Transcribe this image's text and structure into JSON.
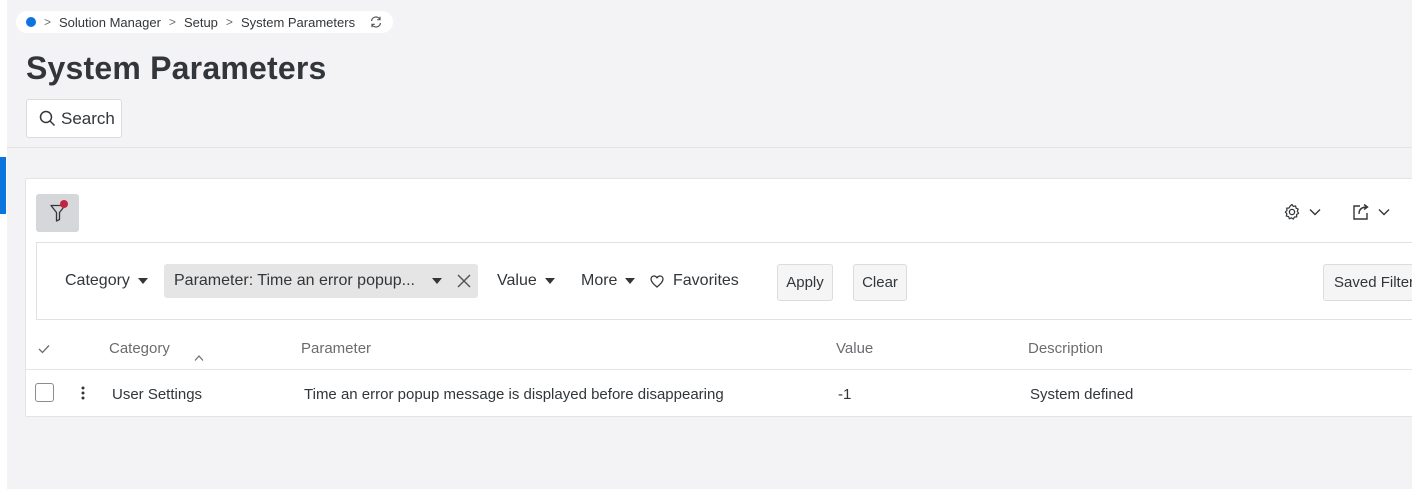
{
  "breadcrumb": {
    "items": [
      "Solution Manager",
      "Setup",
      "System Parameters"
    ]
  },
  "page": {
    "title": "System Parameters"
  },
  "search": {
    "label": "Search"
  },
  "filters": {
    "category_label": "Category",
    "parameter_chip": "Parameter: Time an error popup...",
    "value_label": "Value",
    "more_label": "More",
    "favorites_label": "Favorites",
    "apply_label": "Apply",
    "clear_label": "Clear",
    "saved_filters_label": "Saved Filters"
  },
  "table": {
    "columns": [
      "Category",
      "Parameter",
      "Value",
      "Description"
    ],
    "rows": [
      {
        "category": "User Settings",
        "parameter": "Time an error popup message is displayed before disappearing",
        "value": "-1",
        "description": "System defined"
      }
    ]
  },
  "icons": {
    "filter": "filter-icon",
    "settings": "gear-icon",
    "export": "export-icon",
    "refresh": "refresh-icon",
    "search": "search-icon",
    "remove": "close-icon",
    "favorite": "heart-icon",
    "row_menu": "kebab-menu-icon"
  },
  "colors": {
    "accent": "#0b74de",
    "filter_dot": "#c0263f",
    "chip_bg": "#e5e5e5"
  }
}
